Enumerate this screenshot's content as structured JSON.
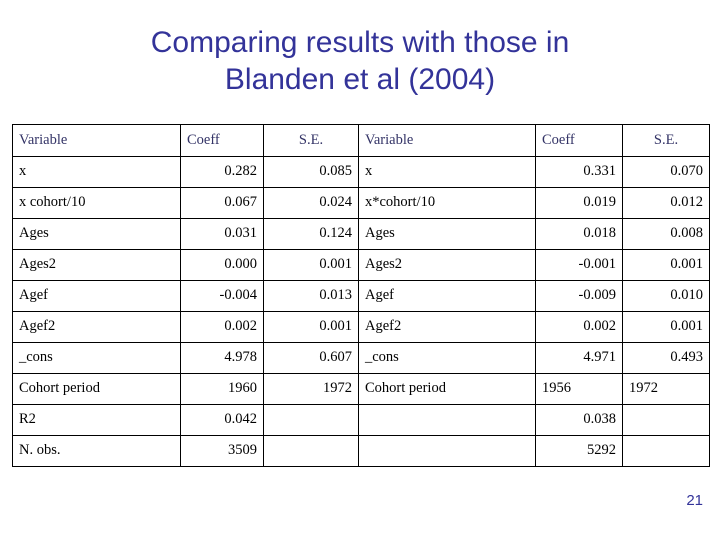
{
  "slide": {
    "title_lines": [
      "Comparing results with those in",
      "Blanden et al (2004)"
    ],
    "page_number": "21",
    "colors": {
      "title": "#333399",
      "table_header_text": "#333366",
      "table_body_text": "#000000",
      "table_border": "#000000",
      "background": "#ffffff"
    }
  },
  "table": {
    "headers": [
      {
        "label": "Variable",
        "align": "left"
      },
      {
        "label": "Coeff",
        "align": "left"
      },
      {
        "label": "S.E.",
        "align": "center"
      },
      {
        "label": "Variable",
        "align": "left"
      },
      {
        "label": "Coeff",
        "align": "left"
      },
      {
        "label": "S.E.",
        "align": "center"
      }
    ],
    "rows": [
      {
        "left_variable": "x",
        "left_coeff": "0.282",
        "left_se": "0.085",
        "right_variable": "x",
        "right_coeff": "0.331",
        "right_se": "0.070",
        "right_coeff_align": "right",
        "right_se_align": "right"
      },
      {
        "left_variable": "x cohort/10",
        "left_coeff": "0.067",
        "left_se": "0.024",
        "right_variable": "x*cohort/10",
        "right_coeff": "0.019",
        "right_se": "0.012",
        "right_coeff_align": "right",
        "right_se_align": "right"
      },
      {
        "left_variable": "Ages",
        "left_coeff": "0.031",
        "left_se": "0.124",
        "right_variable": "Ages",
        "right_coeff": "0.018",
        "right_se": "0.008",
        "right_coeff_align": "right",
        "right_se_align": "right"
      },
      {
        "left_variable": "Ages2",
        "left_coeff": "0.000",
        "left_se": "0.001",
        "right_variable": "Ages2",
        "right_coeff": "-0.001",
        "right_se": "0.001",
        "right_coeff_align": "right",
        "right_se_align": "right"
      },
      {
        "left_variable": "Agef",
        "left_coeff": "-0.004",
        "left_se": "0.013",
        "right_variable": "Agef",
        "right_coeff": "-0.009",
        "right_se": "0.010",
        "right_coeff_align": "right",
        "right_se_align": "right"
      },
      {
        "left_variable": "Agef2",
        "left_coeff": "0.002",
        "left_se": "0.001",
        "right_variable": "Agef2",
        "right_coeff": "0.002",
        "right_se": "0.001",
        "right_coeff_align": "right",
        "right_se_align": "right"
      },
      {
        "left_variable": "_cons",
        "left_coeff": "4.978",
        "left_se": "0.607",
        "right_variable": "_cons",
        "right_coeff": "4.971",
        "right_se": "0.493",
        "right_coeff_align": "right",
        "right_se_align": "right"
      },
      {
        "left_variable": "Cohort period",
        "left_coeff": "1960",
        "left_se": "1972",
        "right_variable": "Cohort period",
        "right_coeff": "1956",
        "right_se": "1972",
        "right_coeff_align": "left",
        "right_se_align": "left"
      },
      {
        "left_variable": "R2",
        "left_coeff": "0.042",
        "left_se": "",
        "right_variable": "",
        "right_coeff": "0.038",
        "right_se": "",
        "right_coeff_align": "right",
        "right_se_align": "right"
      },
      {
        "left_variable": "N. obs.",
        "left_coeff": "3509",
        "left_se": "",
        "right_variable": "",
        "right_coeff": "5292",
        "right_se": "",
        "right_coeff_align": "right",
        "right_se_align": "right"
      }
    ]
  }
}
